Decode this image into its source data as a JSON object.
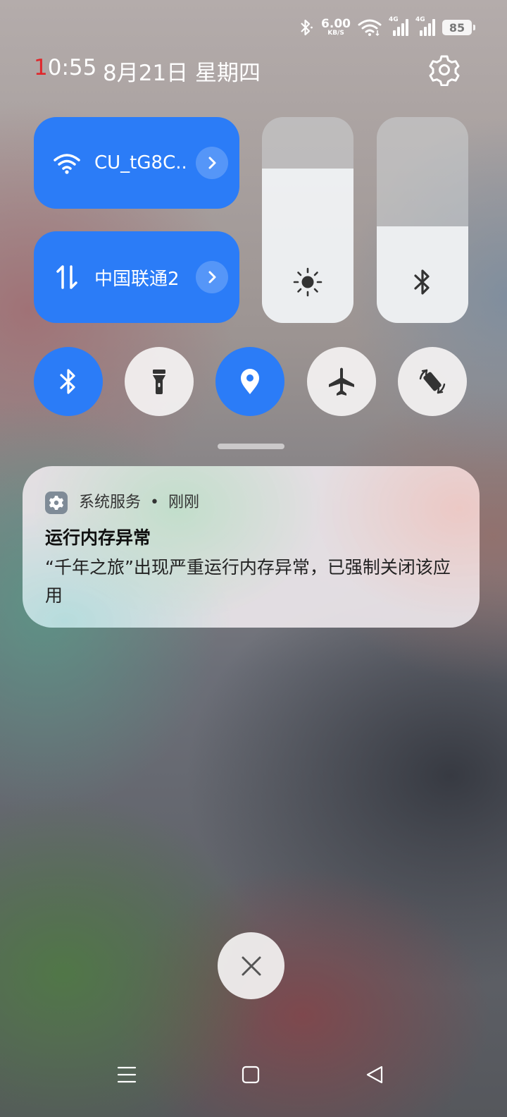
{
  "status_bar": {
    "speed_value": "6.00",
    "speed_unit": "KB/S",
    "sim1_tag": "4G",
    "sim2_tag": "4G",
    "battery": "85"
  },
  "header": {
    "time_first": "1",
    "time_rest": "0:55",
    "date": "8月21日 星期四"
  },
  "tiles": {
    "wifi_label": "CU_tG8C..",
    "mobile_label": "中国联通2"
  },
  "sliders": {
    "brightness_level": 0.75,
    "volume_level": 0.47
  },
  "toggles": {
    "bluetooth": "on",
    "flashlight": "off",
    "location": "on",
    "airplane": "off",
    "auto_rotate": "off"
  },
  "notification": {
    "app_name": "系统服务",
    "separator": "•",
    "time": "刚刚",
    "title": "运行内存异常",
    "body": "“千年之旅”出现严重运行内存异常，已强制关闭该应用"
  },
  "colors": {
    "accent": "#2b7cf7",
    "time_highlight": "#e0262a"
  }
}
